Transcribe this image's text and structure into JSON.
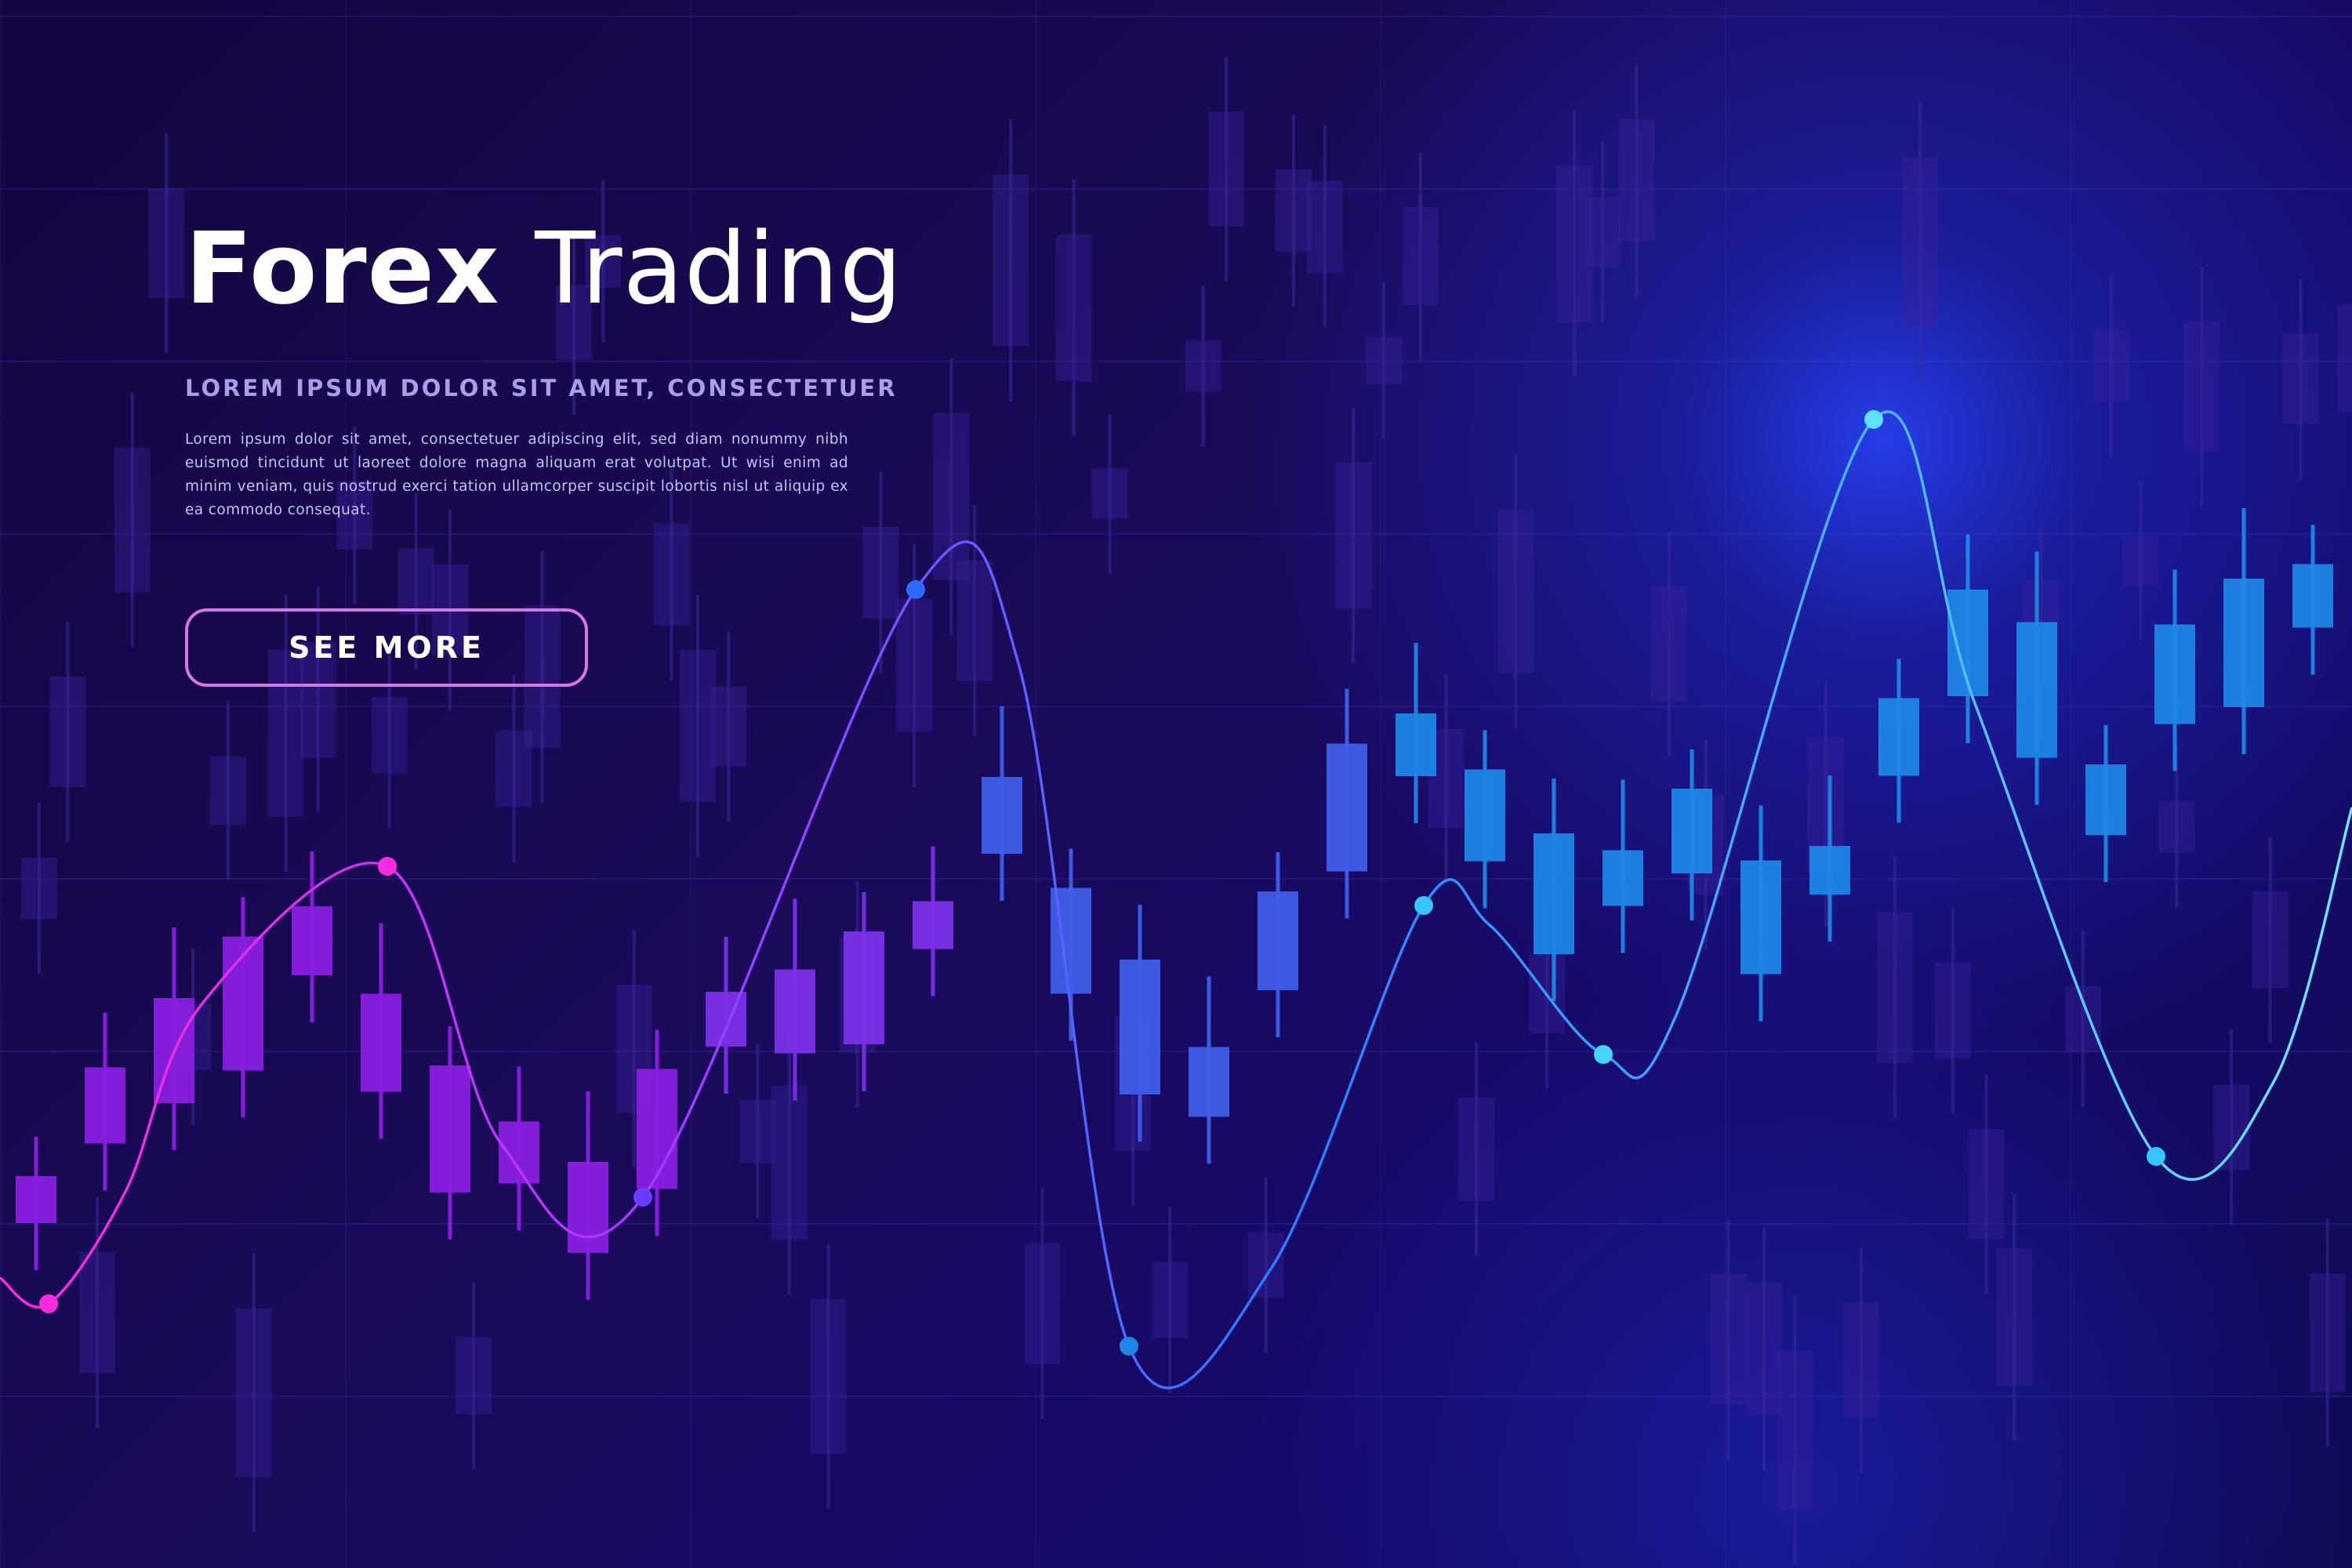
{
  "hero": {
    "title_bold": "Forex",
    "title_light": "Trading",
    "subtitle": "LOREM IPSUM DOLOR SIT AMET, CONSECTETUER",
    "paragraph": "Lorem ipsum dolor sit amet, consectetuer adipiscing elit, sed diam nonummy nibh euismod tincidunt ut laoreet dolore magna aliquam erat volutpat. Ut wisi enim ad minim veniam, quis nostrud exerci tation ullamcorper suscipit lobortis nisl ut aliquip ex ea commodo consequat.",
    "cta_label": "SEE MORE"
  },
  "colors": {
    "background": "#14063f",
    "accent_magenta": "#ff2be0",
    "accent_purple": "#8a2be2",
    "accent_blue": "#2a7bff",
    "accent_cyan": "#5fe0ff",
    "button_border": "#d777e6"
  },
  "decor": {
    "style": "candlestick chart with smooth wave line",
    "grid": true
  }
}
